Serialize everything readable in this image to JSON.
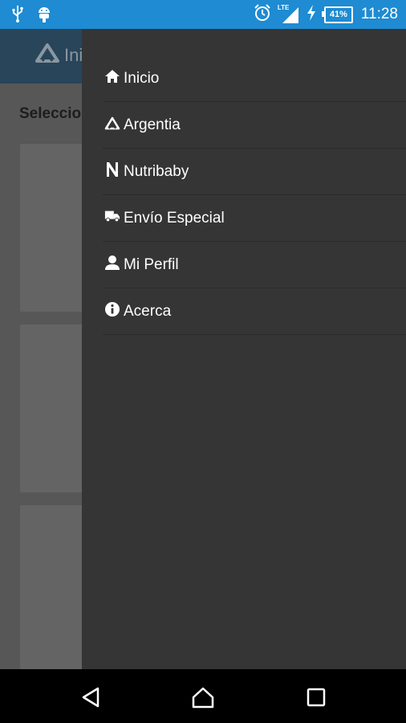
{
  "status_bar": {
    "time": "11:28",
    "battery": "41%",
    "network": "LTE",
    "icons": [
      "usb-icon",
      "android-debug-icon",
      "alarm-icon",
      "signal-icon",
      "charging-icon",
      "battery-icon"
    ]
  },
  "background_app": {
    "header_title": "Ini",
    "section_title": "Seleccio"
  },
  "drawer": {
    "items": [
      {
        "label": "Inicio",
        "icon": "home-icon"
      },
      {
        "label": "Argentia",
        "icon": "argentia-logo-icon"
      },
      {
        "label": "Nutribaby",
        "icon": "nutribaby-n-icon"
      },
      {
        "label": "Envío Especial",
        "icon": "delivery-truck-icon"
      },
      {
        "label": "Mi Perfil",
        "icon": "user-icon"
      },
      {
        "label": "Acerca",
        "icon": "info-icon"
      }
    ]
  },
  "nav_bar": {
    "buttons": [
      "back-icon",
      "home-icon",
      "recents-icon"
    ]
  },
  "colors": {
    "status_bar": "#1e8bd2",
    "drawer_bg": "#353535",
    "dim_overlay": "#575757",
    "app_header": "#28455a"
  }
}
